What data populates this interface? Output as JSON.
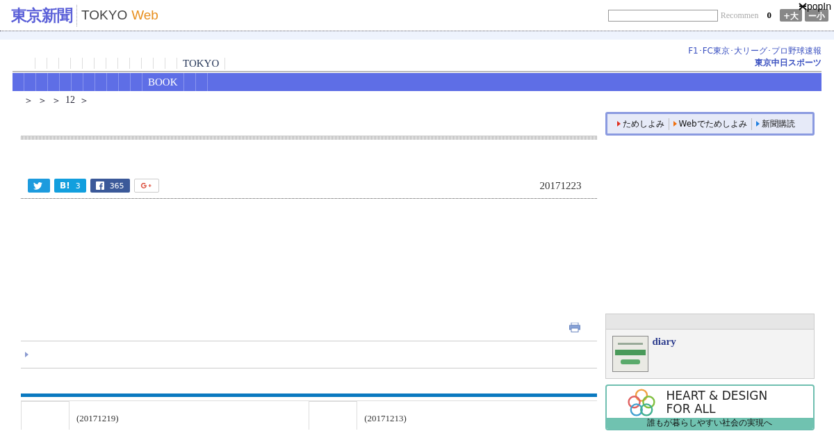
{
  "header": {
    "logo_kanji": "東京新聞",
    "logo_tokyo": "TOKYO",
    "logo_web": "Web",
    "recommend": "Recommen",
    "count": "0",
    "font_buttons": [
      "+大",
      "ー小"
    ],
    "popin": "popIn"
  },
  "sports_ad": {
    "line": "F1･FC東京･大リーグ･プロ野球速報",
    "name": "東京中日スポーツ"
  },
  "nav": {
    "top_item": "TOKYO",
    "bar_item": "BOOK"
  },
  "breadcrumb": [
    "＞",
    "＞",
    "＞",
    "12",
    "＞"
  ],
  "subscribe_links": [
    {
      "label": "ためしよみ",
      "color": "#e03020"
    },
    {
      "label": "Webでためしよみ",
      "color": "#f07010"
    },
    {
      "label": "新聞購読",
      "color": "#2080e0"
    }
  ],
  "share": [
    {
      "kind": "twitter"
    },
    {
      "kind": "hatena",
      "label": "B!",
      "count": "3"
    },
    {
      "kind": "facebook",
      "count": "365"
    },
    {
      "kind": "gplus"
    }
  ],
  "article_date": "20171223",
  "sidebar": {
    "diary_title": "diary",
    "banner": {
      "line1": "HEART & DESIGN",
      "line2": "FOR ALL",
      "caption": "誰もが暮らしやすい社会の実現へ"
    }
  },
  "related": [
    {
      "date": "(20171219)"
    },
    {
      "date": "(20171213)"
    }
  ]
}
